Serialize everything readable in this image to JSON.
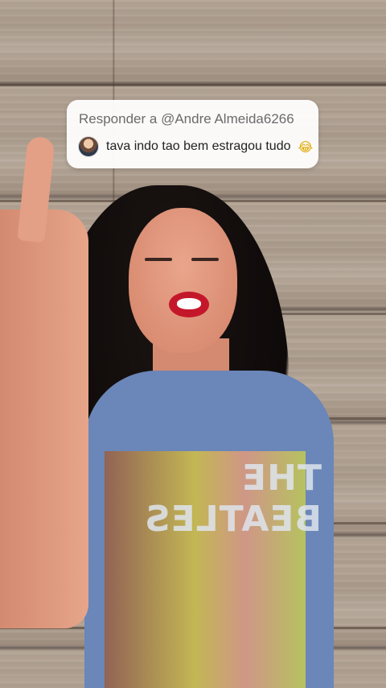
{
  "reply": {
    "title": "Responder a @Andre Almeida6266",
    "comment": "tava indo tao bem estragou tudo",
    "emoji": "😂",
    "avatar_icon": "user-avatar"
  },
  "shirt_print": {
    "text": "THE BEATLES"
  }
}
